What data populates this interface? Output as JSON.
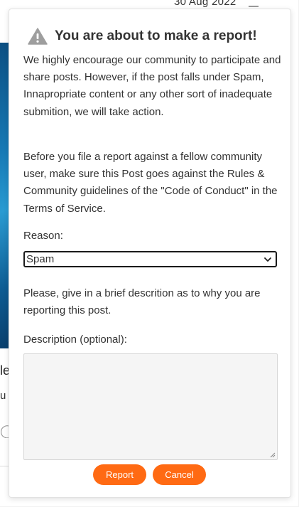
{
  "background": {
    "date": "30 Aug 2022",
    "text_a": "le",
    "text_b": "u"
  },
  "modal": {
    "title": "You are about to make a report!",
    "paragraph_1": "We highly encourage our community to participate and share posts. However, if the post falls under Spam, Innapropriate content or any other sort of inadequate submition, we will take action.",
    "paragraph_2": "Before you file a report against a fellow community user, make sure this Post goes against the Rules & Community guidelines of the \"Code of Conduct\" in the Terms of Service.",
    "reason_label": "Reason:",
    "reason_selected": "Spam",
    "paragraph_3": "Please, give in a brief descrition as to why you are reporting this post.",
    "description_label": "Description (optional):",
    "description_value": "",
    "report_button": "Report",
    "cancel_button": "Cancel"
  },
  "icons": {
    "warning": "warning-icon",
    "select_chevron": "chevron-down-icon"
  },
  "colors": {
    "accent": "#ff6a13",
    "textarea_bg": "#f5f5f5"
  }
}
